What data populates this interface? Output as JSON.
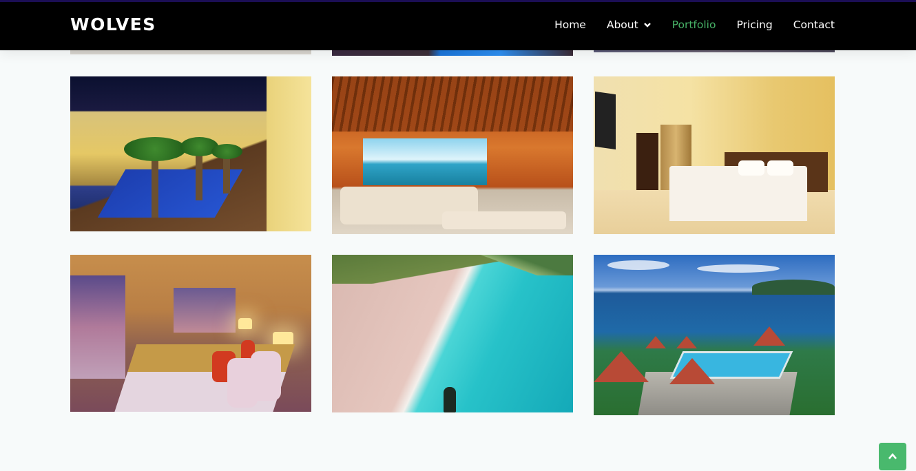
{
  "brand": {
    "name": "WOLVES"
  },
  "nav": {
    "items": [
      {
        "label": "Home"
      },
      {
        "label": "About"
      },
      {
        "label": "Portfolio"
      },
      {
        "label": "Pricing"
      },
      {
        "label": "Contact"
      }
    ],
    "active": "Portfolio",
    "active_color": "#47b267"
  },
  "colors": {
    "topline": "#1b0e55",
    "navbar": "#000000",
    "accent": "#49b96d",
    "background": "#f7fafa"
  },
  "portfolio": {
    "images": [
      {
        "subject": "hotel courtyard with pool at night"
      },
      {
        "subject": "open-air villa living room with ocean view"
      },
      {
        "subject": "hotel room with bed"
      },
      {
        "subject": "bedroom with sunset view"
      },
      {
        "subject": "pink sand beach with turquoise water"
      },
      {
        "subject": "aerial view of resort with pool"
      }
    ]
  },
  "icons": {
    "scroll_top": "chevron-up-icon",
    "dropdown": "chevron-down-icon"
  }
}
